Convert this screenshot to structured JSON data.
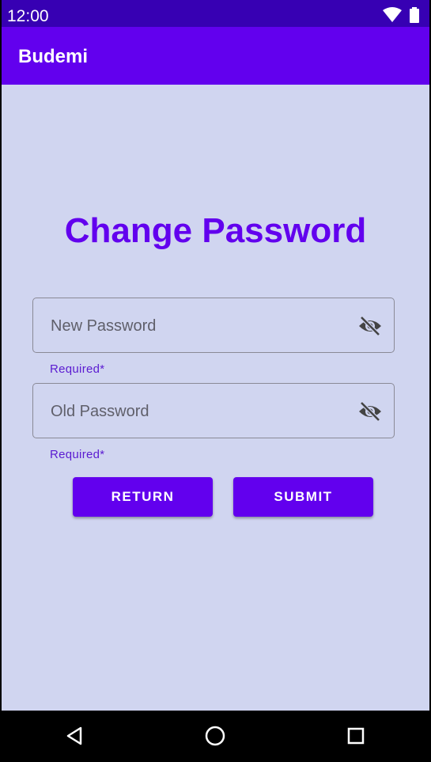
{
  "status_bar": {
    "time": "12:00",
    "icons": [
      "wifi-icon",
      "battery-icon"
    ]
  },
  "app_bar": {
    "title": "Budemi"
  },
  "page": {
    "title": "Change Password"
  },
  "form": {
    "new_password": {
      "placeholder": "New Password",
      "value": "",
      "helper": "Required*",
      "icon": "visibility-off-icon"
    },
    "old_password": {
      "placeholder": "Old Password",
      "value": "",
      "helper": "Required*",
      "icon": "visibility-off-icon"
    },
    "return_label": "RETURN",
    "submit_label": "SUBMIT"
  },
  "nav_bar": {
    "icons": [
      "back-icon",
      "home-icon",
      "recents-icon"
    ]
  },
  "colors": {
    "primary": "#6200ee",
    "primary_dark": "#3700b3",
    "background": "#d0d5f0"
  }
}
